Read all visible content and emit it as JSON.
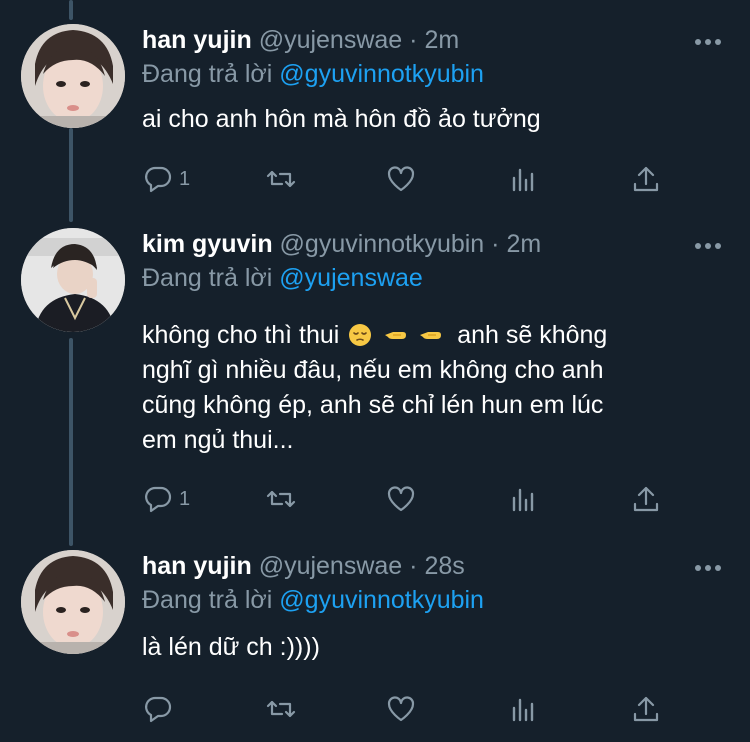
{
  "colors": {
    "background": "#15202b",
    "secondary_text": "#8899a6",
    "mention": "#1da1f2",
    "thread_line": "#3d5466"
  },
  "tweets": [
    {
      "name": "han yujin",
      "handle": "@yujenswae",
      "separator": "·",
      "time": "2m",
      "reply_prefix": "Đang trả lời",
      "reply_to": "@gyuvinnotkyubin",
      "text": "ai cho anh hôn mà hôn đồ ảo tưởng",
      "reply_count": "1",
      "avatar_icon": "profile-photo"
    },
    {
      "name": "kim gyuvin",
      "handle": "@gyuvinnotkyubin",
      "separator": "·",
      "time": "2m",
      "reply_prefix": "Đang trả lời",
      "reply_to": "@yujenswae",
      "text_line1_a": "không cho thì thui",
      "text_line1_b": "anh sẽ không",
      "text_line2": "nghĩ gì nhiều đâu, nếu em không cho anh",
      "text_line3": "cũng không ép, anh sẽ chỉ lén hun em lúc",
      "text_line4": "em ngủ thui...",
      "emojis": [
        "pensive-face-icon",
        "backhand-index-pointing-left-icon",
        "backhand-index-pointing-left-icon"
      ],
      "reply_count": "1",
      "avatar_icon": "profile-photo"
    },
    {
      "name": "han yujin",
      "handle": "@yujenswae",
      "separator": "·",
      "time": "28s",
      "reply_prefix": "Đang trả lời",
      "reply_to": "@gyuvinnotkyubin",
      "text": "là lén dữ ch :))))",
      "reply_count": "",
      "avatar_icon": "profile-photo"
    }
  ]
}
